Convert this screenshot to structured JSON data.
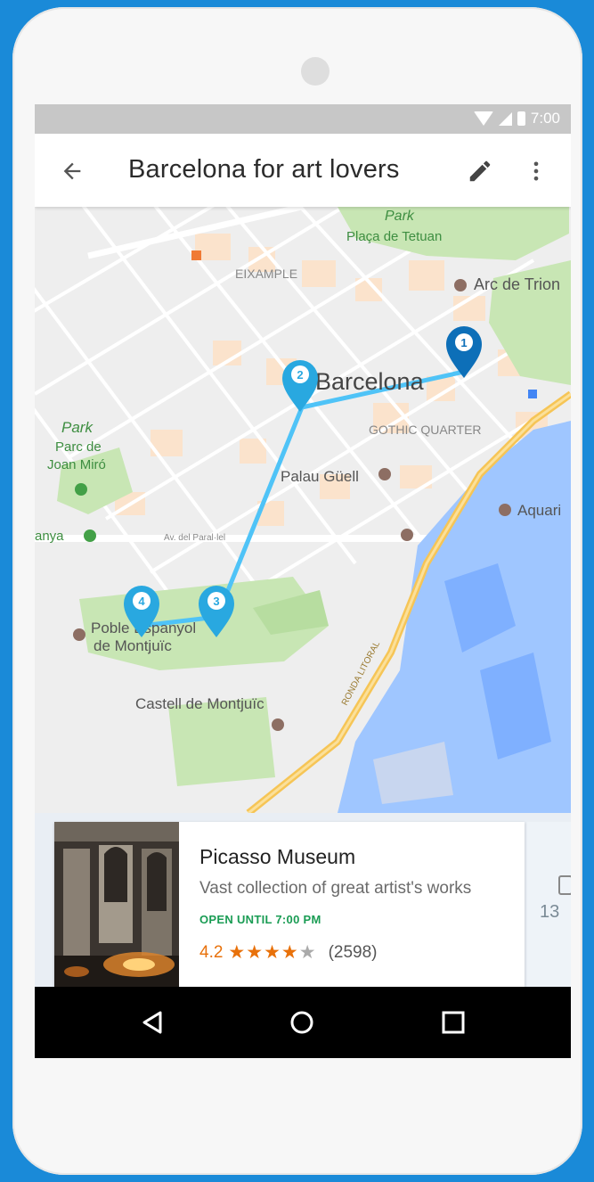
{
  "status": {
    "time": "7:00"
  },
  "appbar": {
    "title": "Barcelona for art lovers"
  },
  "map": {
    "labels": {
      "park_top": "Park",
      "placa_tetuan": "Plaça de Tetuan",
      "eixample": "EIXAMPLE",
      "arc_de_triomf": "Arc de Trion",
      "barcelona": "Barcelona",
      "gothic_quarter": "GOTHIC QUARTER",
      "park_left": "Park",
      "parc_joan_miro_1": "Parc de",
      "parc_joan_miro_2": "Joan Miró",
      "palau_guell": "Palau Güell",
      "aquarium": "Aquari",
      "espanya": "anya",
      "av_parallel": "Av. del Paral·lel",
      "poble_espanyol_1": "Poble Espanyol",
      "poble_espanyol_2": "de Montjuïc",
      "castell_montjuic": "Castell de Montjuïc",
      "ronda": "RONDA LITORAL"
    },
    "pins": [
      "1",
      "2",
      "3",
      "4"
    ],
    "colors": {
      "route": "#4fc3f7",
      "pin": "#29a8e0",
      "pin_active": "#0d6fb8"
    }
  },
  "card": {
    "name": "Picasso Museum",
    "description": "Vast collection of great artist's works",
    "open_status": "OPEN UNTIL 7:00 PM",
    "rating": "4.2",
    "stars": [
      "★",
      "★",
      "★",
      "★",
      "★"
    ],
    "reviews": "(2598)",
    "peek_number": "13"
  },
  "nav": {
    "back": "back",
    "home": "home",
    "recents": "recents"
  }
}
